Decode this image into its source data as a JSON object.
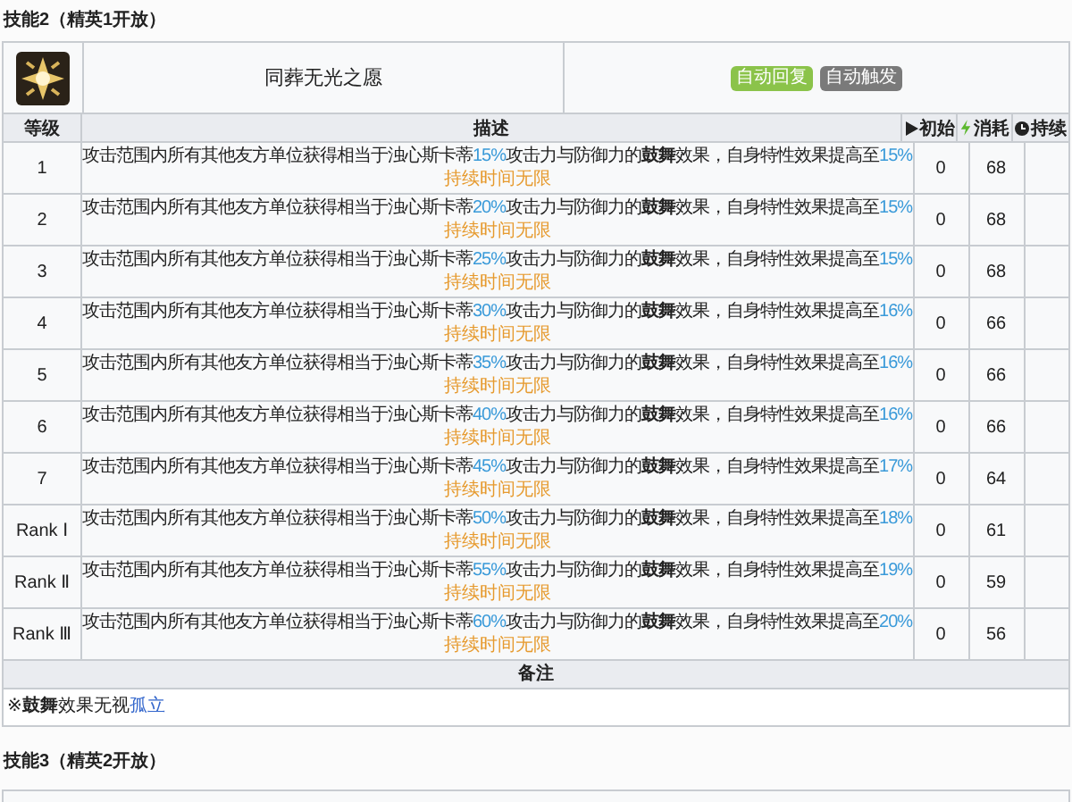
{
  "heading": "技能2（精英1开放）",
  "skill": {
    "name": "同葬无光之愿",
    "tags": [
      {
        "label": "自动回复",
        "color": "#8bc34a"
      },
      {
        "label": "自动触发",
        "color": "#7a7a7a"
      }
    ]
  },
  "columns": [
    {
      "label": "等级",
      "kind": "plain"
    },
    {
      "label": "描述",
      "kind": "plain"
    },
    {
      "label": "初始",
      "kind": "play"
    },
    {
      "label": "消耗",
      "kind": "bolt"
    },
    {
      "label": "持续",
      "kind": "clock"
    }
  ],
  "rows": [
    {
      "level": "1",
      "desc": [
        "攻击范围内所有其他友方单位获得相当于浊心斯卡蒂",
        "15%",
        "攻击力与防御力的**鼓舞**效果，自身特性效果提高至",
        "15%"
      ],
      "note": "持续时间无限",
      "initial": "0",
      "cost": "68"
    },
    {
      "level": "2",
      "desc": [
        "攻击范围内所有其他友方单位获得相当于浊心斯卡蒂",
        "20%",
        "攻击力与防御力的**鼓舞**效果，自身特性效果提高至",
        "15%"
      ],
      "note": "持续时间无限",
      "initial": "0",
      "cost": "68"
    },
    {
      "level": "3",
      "desc": [
        "攻击范围内所有其他友方单位获得相当于浊心斯卡蒂",
        "25%",
        "攻击力与防御力的**鼓舞**效果，自身特性效果提高至",
        "15%"
      ],
      "note": "持续时间无限",
      "initial": "0",
      "cost": "68"
    },
    {
      "level": "4",
      "desc": [
        "攻击范围内所有其他友方单位获得相当于浊心斯卡蒂",
        "30%",
        "攻击力与防御力的**鼓舞**效果，自身特性效果提高至",
        "16%"
      ],
      "note": "持续时间无限",
      "initial": "0",
      "cost": "66"
    },
    {
      "level": "5",
      "desc": [
        "攻击范围内所有其他友方单位获得相当于浊心斯卡蒂",
        "35%",
        "攻击力与防御力的**鼓舞**效果，自身特性效果提高至",
        "16%"
      ],
      "note": "持续时间无限",
      "initial": "0",
      "cost": "66"
    },
    {
      "level": "6",
      "desc": [
        "攻击范围内所有其他友方单位获得相当于浊心斯卡蒂",
        "40%",
        "攻击力与防御力的**鼓舞**效果，自身特性效果提高至",
        "16%"
      ],
      "note": "持续时间无限",
      "initial": "0",
      "cost": "66"
    },
    {
      "level": "7",
      "desc": [
        "攻击范围内所有其他友方单位获得相当于浊心斯卡蒂",
        "45%",
        "攻击力与防御力的**鼓舞**效果，自身特性效果提高至",
        "17%"
      ],
      "note": "持续时间无限",
      "initial": "0",
      "cost": "64"
    },
    {
      "level": "Rank Ⅰ",
      "desc": [
        "攻击范围内所有其他友方单位获得相当于浊心斯卡蒂",
        "50%",
        "攻击力与防御力的**鼓舞**效果，自身特性效果提高至",
        "18%"
      ],
      "note": "持续时间无限",
      "initial": "0",
      "cost": "61"
    },
    {
      "level": "Rank Ⅱ",
      "desc": [
        "攻击范围内所有其他友方单位获得相当于浊心斯卡蒂",
        "55%",
        "攻击力与防御力的**鼓舞**效果，自身特性效果提高至",
        "19%"
      ],
      "note": "持续时间无限",
      "initial": "0",
      "cost": "59"
    },
    {
      "level": "Rank Ⅲ",
      "desc": [
        "攻击范围内所有其他友方单位获得相当于浊心斯卡蒂",
        "60%",
        "攻击力与防御力的**鼓舞**效果，自身特性效果提高至",
        "20%"
      ],
      "note": "持续时间无限",
      "initial": "0",
      "cost": "56"
    }
  ],
  "remarks": {
    "title": "备注",
    "text": [
      "※**鼓舞**效果无视",
      "孤立"
    ]
  },
  "next_heading": "技能3（精英2开放）"
}
